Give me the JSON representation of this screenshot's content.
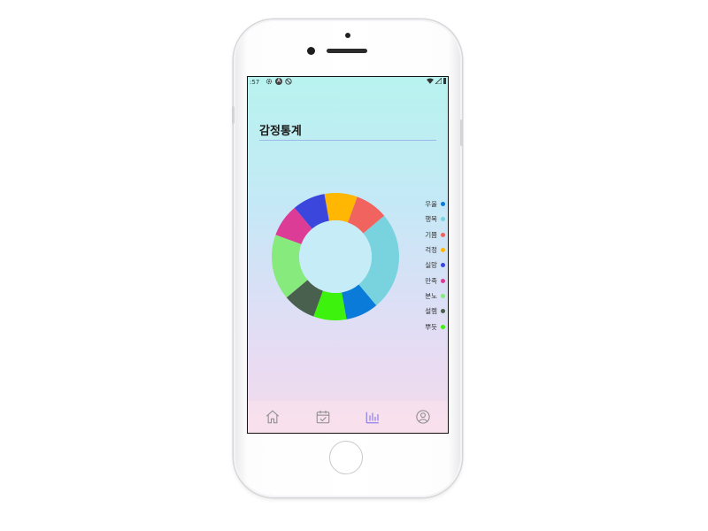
{
  "status_bar": {
    "time": ":57"
  },
  "page": {
    "title": "감정통계"
  },
  "chart_data": {
    "type": "pie",
    "title": "감정통계",
    "donut": true,
    "legend_position": "right",
    "categories": [
      "우울",
      "행복",
      "기쁨",
      "걱정",
      "실망",
      "만족",
      "분노",
      "설렘",
      "뿌듯"
    ],
    "values": [
      1,
      3,
      1,
      1,
      1,
      1,
      2,
      1,
      1
    ],
    "colors": [
      "#0b7bd9",
      "#78d3de",
      "#f0635e",
      "#ffb703",
      "#3b47dc",
      "#dc3c96",
      "#86ea7c",
      "#48604d",
      "#3df20c"
    ]
  },
  "bottom_nav": {
    "items": [
      {
        "name": "home-icon",
        "active": false
      },
      {
        "name": "calendar-icon",
        "active": false
      },
      {
        "name": "stats-icon",
        "active": true
      },
      {
        "name": "profile-icon",
        "active": false
      }
    ],
    "active_color": "#8b7dea",
    "inactive_color": "#8a8a8a"
  }
}
